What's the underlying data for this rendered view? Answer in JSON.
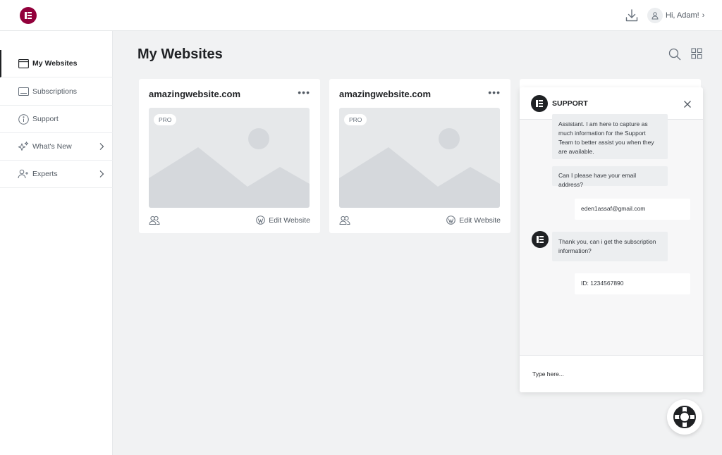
{
  "header": {
    "user_greeting": "Hi, Adam!",
    "brand_color": "#92003b"
  },
  "sidebar": {
    "items": [
      {
        "label": "My Websites",
        "icon": "browser-window-icon",
        "active": true
      },
      {
        "label": "Subscriptions",
        "icon": "card-icon"
      },
      {
        "label": "Support",
        "icon": "info-circle-icon"
      },
      {
        "label": "What's New",
        "icon": "sparkles-icon"
      },
      {
        "label": "Experts",
        "icon": "add-user-icon"
      }
    ]
  },
  "main": {
    "title": "My Websites",
    "cards": [
      {
        "title": "amazingwebsite.com",
        "badge": "PRO",
        "action": "Edit Website"
      },
      {
        "title": "amazingwebsite.com",
        "badge": "PRO",
        "action": "Edit Website"
      }
    ]
  },
  "chat": {
    "title": "SUPPORT",
    "messages": [
      {
        "from": "bot",
        "text": "Assistant. I am here to capture as much information for the Support Team to better assist you when they are available."
      },
      {
        "from": "bot",
        "text": "Can I please have your email address?"
      },
      {
        "from": "user",
        "text": "eden1assaf@gmail.com"
      },
      {
        "from": "bot",
        "text": "Thank you, can i get the subscription information?"
      },
      {
        "from": "user",
        "text": "ID: 1234567890"
      }
    ],
    "input_placeholder": "Type here..."
  }
}
